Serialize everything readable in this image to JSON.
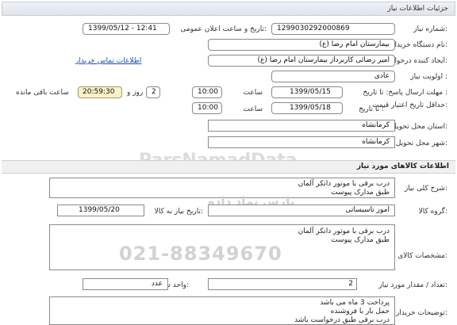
{
  "header": {
    "title": "جزئیات اطلاعات نیاز"
  },
  "fields": {
    "need_number_label": "شماره نیاز:",
    "need_number": "1299030292000869",
    "announce_label": "تاریخ و ساعت اعلان عمومی:",
    "announce_value": "1399/05/12 - 12:41",
    "buyer_label": "نام دستگاه خریدار:",
    "buyer": "بیمارستان امام رضا (ع)",
    "creator_label": "ایجاد کننده درخواست:",
    "creator": "امیر رضائی کاربرداز بیمارستان امام رضا (ع)",
    "contact_link": "اطلاعات تماس خریدار",
    "priority_label": "اولویت نیاز :",
    "priority": "عادی",
    "reply_deadline_label": "مهلت ارسال پاسخ: تا تاریخ :",
    "reply_date": "1399/05/15",
    "time_label": "ساعت",
    "reply_time": "10:00",
    "days_value": "2",
    "days_label": "روز و",
    "remaining_time": "20:59:30",
    "remaining_label": "ساعت باقی مانده",
    "price_validity_label": "حداقل تاریخ اعتبار قیمت:",
    "to_date_label": "تا تاریخ :",
    "price_date": "1399/05/18",
    "price_time": "10:00",
    "delivery_province_label": "استان محل تحویل:",
    "delivery_province": "کرمانشاه",
    "delivery_city_label": "شهر محل تحویل:",
    "delivery_city": "کرمانشاه"
  },
  "goods_section": {
    "title": "اطلاعات کالاهای مورد نیاز",
    "summary_label": "شرح کلی نیاز:",
    "summary_lines": [
      "درب برقی با موتور دانکر آلمان",
      "طبق مدارک پیوست"
    ],
    "group_label": "گروه کالا:",
    "group_value": "امور تاسیساتی",
    "need_date_label": "تاریخ نیاز به کالا:",
    "need_date": "1399/05/20",
    "specs_label": "مشخصات کالای مورد نیاز:",
    "specs_lines": [
      "درب برقی با موتور دانکر آلمان",
      "طبق مدارک پیوست"
    ],
    "qty_label": "تعداد / مقدار مورد نیاز:",
    "qty": "2",
    "unit_label": "واحد شمارش:",
    "unit": "عدد",
    "buyer_notes_label": "توضیحات خریدار:",
    "buyer_notes_lines": [
      "پرداخت 3 ماه می باشد",
      "حمل بار با فروشنده",
      "درب برقی طبق درخواست باشد"
    ]
  },
  "watermark": {
    "brand": "ParsNamadData",
    "persian": "پارس نماد داده",
    "phone": "021-88349670"
  }
}
